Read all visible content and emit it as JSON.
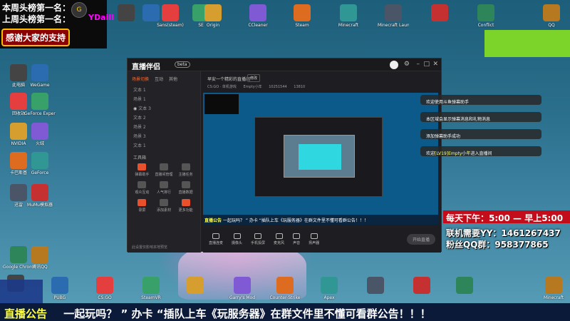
{
  "overlay": {
    "rank1": "本周头榜第一名：",
    "rank2": "上周头榜第一名：",
    "rank2_name": "YDaill",
    "thanks": "感谢大家的支持"
  },
  "desktop_icons": {
    "top_row": [
      "",
      "",
      "Sans(steam)",
      "SE",
      "Origin",
      "CCleaner",
      "Steam",
      "Minecraft",
      "Minecraft Launcher",
      "",
      "Conflict",
      "QQ"
    ],
    "left_col": [
      "此电脑",
      "WeGame",
      "回收站",
      "GeForce Experience",
      "NVIDIA",
      "火绒",
      "卡巴斯基",
      "GeForce",
      "迅雷",
      "MuMu模拟器",
      "Google Chrome",
      "腾讯QQ"
    ],
    "bottom_row": [
      "",
      "PUBG",
      "CS:GO",
      "SteamVR",
      "",
      "Garry's Mod",
      "Counter-Strike",
      "Apex",
      "",
      "",
      "",
      "Minecraft"
    ]
  },
  "app": {
    "name": "直播伴侣",
    "badge": "beta",
    "left_tabs": [
      "场景切换",
      "互动",
      "其他"
    ],
    "scenes": [
      "文本 1",
      "场景 1",
      "文本 3",
      "文本 2",
      "场景 2",
      "场景 3",
      "文本 1"
    ],
    "tools_title": "工具箱",
    "tools": [
      "弹幕助手",
      "直播间管理",
      "主播任务",
      "观众互动",
      "人气排行",
      "直播数据",
      "录屏",
      "添加素材",
      "更多功能"
    ],
    "bottom_note": "此设置仅影响本地预览",
    "live_title": "早安一个精彩的直播间",
    "edit_label": "修改",
    "sub_info": [
      "CS:GO · 单机游戏",
      "Empty小年",
      "10251544",
      "13810"
    ],
    "preview_banner_label": "直播公告",
    "preview_banner_text": "一起玩吗？ ” 办卡 “插队上车《玩服务器》在群文件里不懂可看群公告！！！",
    "bottom_tools": [
      "直播连麦",
      "摄像头",
      "手机投屏",
      "麦克风",
      "声音",
      "扬声器"
    ],
    "start_label": "开始直播"
  },
  "chat": [
    {
      "text": "欢迎使用斗鱼弹幕助手"
    },
    {
      "text": "本区域会显示弹幕消息和礼物消息"
    },
    {
      "text": "添加弹幕助手成功"
    },
    {
      "prefix": "欢迎",
      "name": "[LV19]Empty小年",
      "suffix": "进入直播间"
    }
  ],
  "schedule": "每天下午：5:00 — 早上5:00",
  "contact": {
    "yy": "联机需要YY：1461267437",
    "qq": "粉丝QQ群：958377865"
  },
  "banner": {
    "label": "直播公告",
    "text": "一起玩吗？ ” 办卡 “插队上车《玩服务器》在群文件里不懂可看群公告！！！"
  }
}
